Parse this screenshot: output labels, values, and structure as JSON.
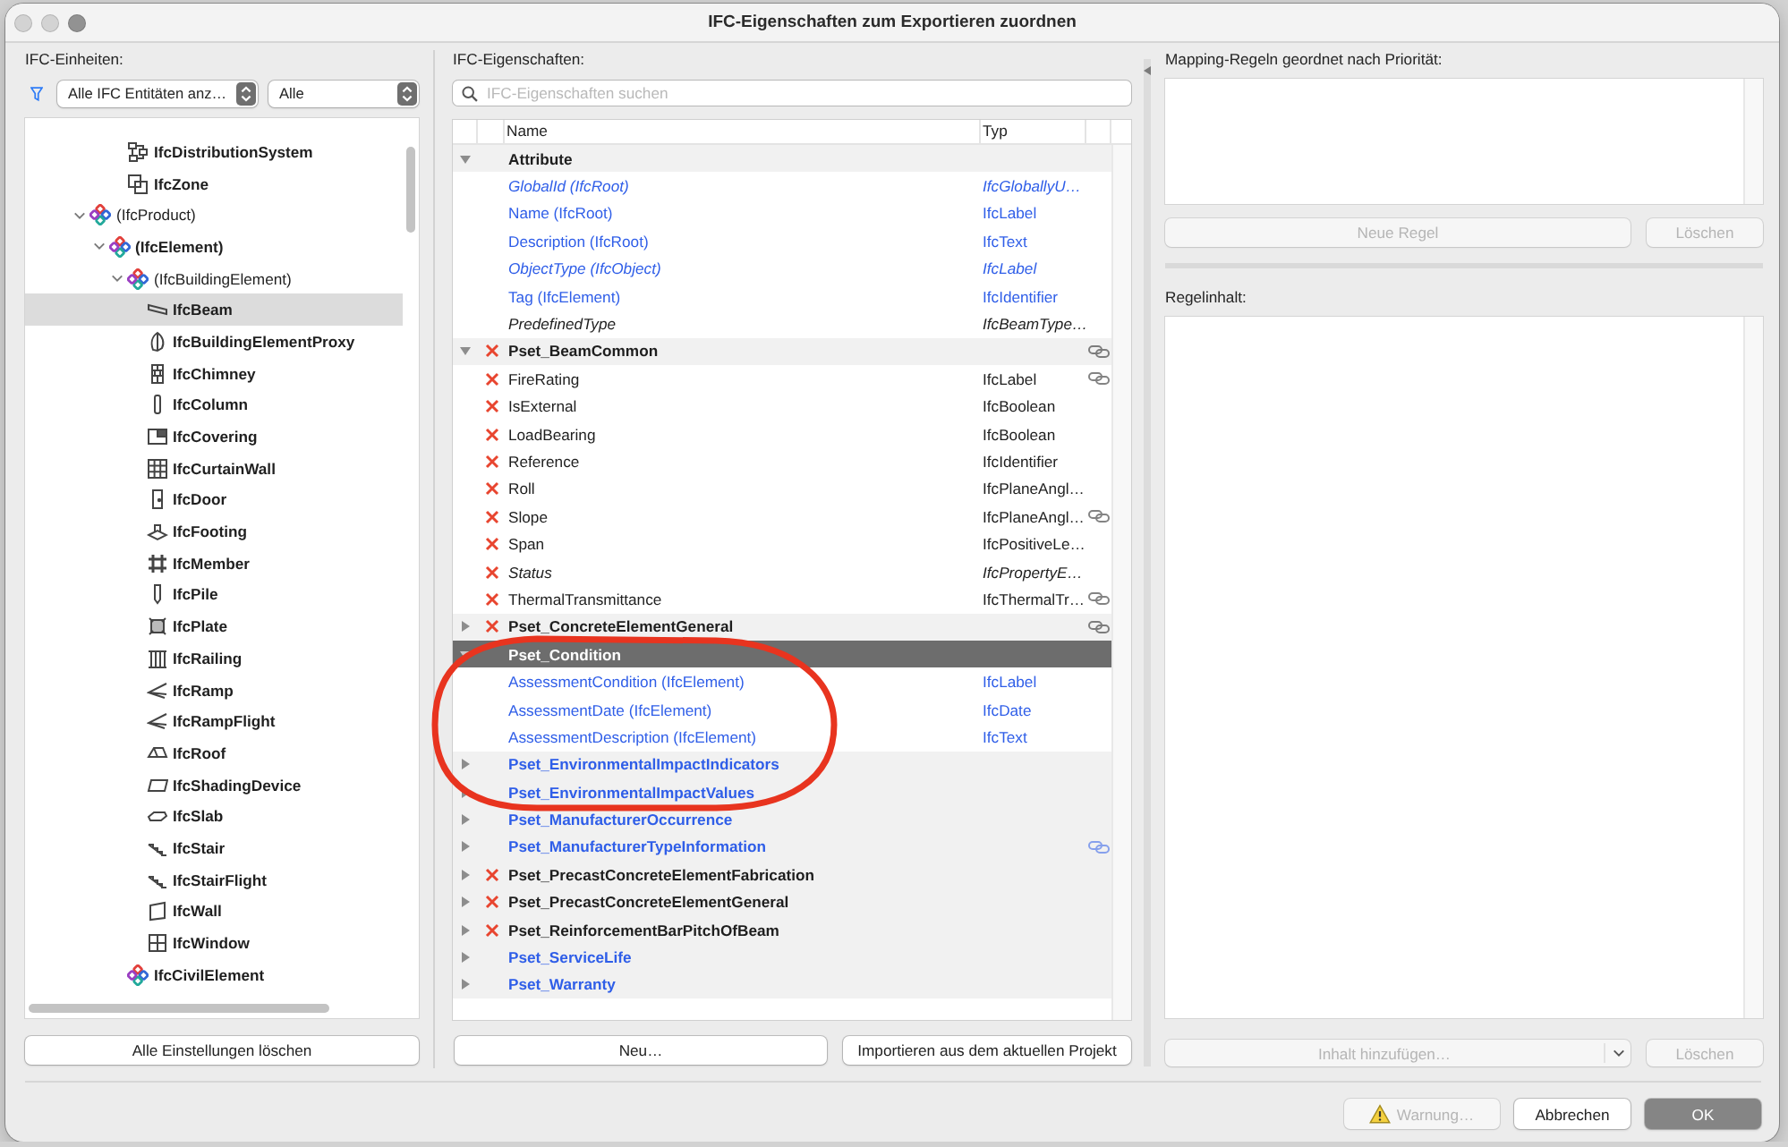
{
  "window": {
    "title": "IFC-Eigenschaften zum Exportieren zuordnen",
    "controls": [
      {
        "disabled": true
      },
      {
        "disabled": true
      },
      {
        "disabled": false
      }
    ]
  },
  "entities_panel": {
    "label": "IFC-Einheiten:",
    "filter_dropdown": "Alle IFC Entitäten anz…",
    "scope_dropdown": "Alle",
    "tree": {
      "upper_branch_items": [
        {
          "label": "IfcDistributionSystem",
          "kind": "system",
          "bold": true,
          "selected": false
        },
        {
          "label": "IfcZone",
          "kind": "zone",
          "bold": true,
          "selected": false
        }
      ],
      "items": [
        {
          "label": "(IfcProduct)",
          "kind": "group",
          "bold": false,
          "selected": false,
          "expanded": true,
          "children": [
            {
              "label": "(IfcElement)",
              "kind": "group",
              "bold": true,
              "selected": false,
              "expanded": true,
              "children": [
                {
                  "label": "(IfcBuildingElement)",
                  "kind": "group",
                  "bold": false,
                  "selected": false,
                  "expanded": true,
                  "children": [
                    {
                      "label": "IfcBeam",
                      "kind": "beam",
                      "bold": true,
                      "selected": true
                    },
                    {
                      "label": "IfcBuildingElementProxy",
                      "kind": "proxy",
                      "bold": true,
                      "selected": false
                    },
                    {
                      "label": "IfcChimney",
                      "kind": "chimney",
                      "bold": true,
                      "selected": false
                    },
                    {
                      "label": "IfcColumn",
                      "kind": "column",
                      "bold": true,
                      "selected": false
                    },
                    {
                      "label": "IfcCovering",
                      "kind": "covering",
                      "bold": true,
                      "selected": false
                    },
                    {
                      "label": "IfcCurtainWall",
                      "kind": "curtainwall",
                      "bold": true,
                      "selected": false
                    },
                    {
                      "label": "IfcDoor",
                      "kind": "door",
                      "bold": true,
                      "selected": false
                    },
                    {
                      "label": "IfcFooting",
                      "kind": "footing",
                      "bold": true,
                      "selected": false
                    },
                    {
                      "label": "IfcMember",
                      "kind": "member",
                      "bold": true,
                      "selected": false
                    },
                    {
                      "label": "IfcPile",
                      "kind": "pile",
                      "bold": true,
                      "selected": false
                    },
                    {
                      "label": "IfcPlate",
                      "kind": "plate",
                      "bold": true,
                      "selected": false
                    },
                    {
                      "label": "IfcRailing",
                      "kind": "railing",
                      "bold": true,
                      "selected": false
                    },
                    {
                      "label": "IfcRamp",
                      "kind": "ramp",
                      "bold": true,
                      "selected": false
                    },
                    {
                      "label": "IfcRampFlight",
                      "kind": "ramp",
                      "bold": true,
                      "selected": false
                    },
                    {
                      "label": "IfcRoof",
                      "kind": "roof",
                      "bold": true,
                      "selected": false
                    },
                    {
                      "label": "IfcShadingDevice",
                      "kind": "shading",
                      "bold": true,
                      "selected": false
                    },
                    {
                      "label": "IfcSlab",
                      "kind": "slab",
                      "bold": true,
                      "selected": false
                    },
                    {
                      "label": "IfcStair",
                      "kind": "stair",
                      "bold": true,
                      "selected": false
                    },
                    {
                      "label": "IfcStairFlight",
                      "kind": "stair",
                      "bold": true,
                      "selected": false
                    },
                    {
                      "label": "IfcWall",
                      "kind": "wall",
                      "bold": true,
                      "selected": false
                    },
                    {
                      "label": "IfcWindow",
                      "kind": "window",
                      "bold": true,
                      "selected": false
                    }
                  ]
                },
                {
                  "label": "IfcCivilElement",
                  "kind": "group",
                  "bold": true,
                  "selected": false
                }
              ]
            }
          ]
        }
      ]
    },
    "button": {
      "label": "Alle Einstellungen löschen"
    }
  },
  "properties_panel": {
    "label": "IFC-Eigenschaften:",
    "search": {
      "placeholder": "IFC-Eigenschaften suchen"
    },
    "columns": [
      "Name",
      "Typ"
    ],
    "property_sets": [
      {
        "name": "Attribute",
        "expanded": true,
        "selected": false,
        "excluded": false,
        "linked": false,
        "color": "#1e1e1e",
        "properties": [
          {
            "name": "GlobalId (IfcRoot)",
            "type": "IfcGloballyU…",
            "excluded": false,
            "italic": true,
            "linked": false,
            "selected": false,
            "color": "#2f5ee8"
          },
          {
            "name": "Name (IfcRoot)",
            "type": "IfcLabel",
            "excluded": false,
            "italic": false,
            "linked": false,
            "selected": false,
            "color": "#2f5ee8"
          },
          {
            "name": "Description (IfcRoot)",
            "type": "IfcText",
            "excluded": false,
            "italic": false,
            "linked": false,
            "selected": false,
            "color": "#2f5ee8"
          },
          {
            "name": "ObjectType (IfcObject)",
            "type": "IfcLabel",
            "excluded": false,
            "italic": true,
            "linked": false,
            "selected": false,
            "color": "#2f5ee8"
          },
          {
            "name": "Tag (IfcElement)",
            "type": "IfcIdentifier",
            "excluded": false,
            "italic": false,
            "linked": false,
            "selected": false,
            "color": "#2f5ee8"
          },
          {
            "name": "PredefinedType",
            "type": "IfcBeamType…",
            "excluded": false,
            "italic": true,
            "linked": false,
            "selected": false,
            "color": "#1e1e1e"
          }
        ]
      },
      {
        "name": "Pset_BeamCommon",
        "expanded": true,
        "selected": false,
        "excluded": true,
        "linked": true,
        "color": "#1e1e1e",
        "properties": [
          {
            "name": "FireRating",
            "type": "IfcLabel",
            "excluded": true,
            "italic": false,
            "linked": true,
            "selected": false,
            "color": "#1e1e1e"
          },
          {
            "name": "IsExternal",
            "type": "IfcBoolean",
            "excluded": true,
            "italic": false,
            "linked": false,
            "selected": false,
            "color": "#1e1e1e"
          },
          {
            "name": "LoadBearing",
            "type": "IfcBoolean",
            "excluded": true,
            "italic": false,
            "linked": false,
            "selected": false,
            "color": "#1e1e1e"
          },
          {
            "name": "Reference",
            "type": "IfcIdentifier",
            "excluded": true,
            "italic": false,
            "linked": false,
            "selected": false,
            "color": "#1e1e1e"
          },
          {
            "name": "Roll",
            "type": "IfcPlaneAngl…",
            "excluded": true,
            "italic": false,
            "linked": false,
            "selected": false,
            "color": "#1e1e1e"
          },
          {
            "name": "Slope",
            "type": "IfcPlaneAngl…",
            "excluded": true,
            "italic": false,
            "linked": true,
            "selected": false,
            "color": "#1e1e1e"
          },
          {
            "name": "Span",
            "type": "IfcPositiveLe…",
            "excluded": true,
            "italic": false,
            "linked": false,
            "selected": false,
            "color": "#1e1e1e"
          },
          {
            "name": "Status",
            "type": "IfcPropertyE…",
            "excluded": true,
            "italic": true,
            "linked": false,
            "selected": false,
            "color": "#1e1e1e"
          },
          {
            "name": "ThermalTransmittance",
            "type": "IfcThermalTr…",
            "excluded": true,
            "italic": false,
            "linked": true,
            "selected": false,
            "color": "#1e1e1e"
          }
        ]
      },
      {
        "name": "Pset_ConcreteElementGeneral",
        "expanded": false,
        "selected": false,
        "excluded": true,
        "linked": true,
        "color": "#1e1e1e"
      },
      {
        "name": "Pset_Condition",
        "expanded": true,
        "selected": true,
        "excluded": false,
        "linked": false,
        "properties": [
          {
            "name": "AssessmentCondition (IfcElement)",
            "type": "IfcLabel",
            "excluded": false,
            "italic": false,
            "linked": false,
            "selected": false,
            "color": "#2f5ee8"
          },
          {
            "name": "AssessmentDate (IfcElement)",
            "type": "IfcDate",
            "excluded": false,
            "italic": false,
            "linked": false,
            "selected": false,
            "color": "#2f5ee8"
          },
          {
            "name": "AssessmentDescription (IfcElement)",
            "type": "IfcText",
            "excluded": false,
            "italic": false,
            "linked": false,
            "selected": false,
            "color": "#2f5ee8"
          }
        ]
      },
      {
        "name": "Pset_EnvironmentalImpactIndicators",
        "expanded": false,
        "selected": false,
        "excluded": false,
        "linked": false,
        "color": "#2f5ee8"
      },
      {
        "name": "Pset_EnvironmentalImpactValues",
        "expanded": false,
        "selected": false,
        "excluded": false,
        "linked": false,
        "color": "#2f5ee8"
      },
      {
        "name": "Pset_ManufacturerOccurrence",
        "expanded": false,
        "selected": false,
        "excluded": false,
        "linked": false,
        "color": "#2f5ee8"
      },
      {
        "name": "Pset_ManufacturerTypeInformation",
        "expanded": false,
        "selected": false,
        "excluded": false,
        "linked": true,
        "color": "#2f5ee8"
      },
      {
        "name": "Pset_PrecastConcreteElementFabrication",
        "expanded": false,
        "selected": false,
        "excluded": true,
        "linked": false,
        "color": "#1e1e1e"
      },
      {
        "name": "Pset_PrecastConcreteElementGeneral",
        "expanded": false,
        "selected": false,
        "excluded": true,
        "linked": false,
        "color": "#1e1e1e"
      },
      {
        "name": "Pset_ReinforcementBarPitchOfBeam",
        "expanded": false,
        "selected": false,
        "excluded": true,
        "linked": false,
        "color": "#1e1e1e"
      },
      {
        "name": "Pset_ServiceLife",
        "expanded": false,
        "selected": false,
        "excluded": false,
        "linked": false,
        "color": "#2f5ee8"
      },
      {
        "name": "Pset_Warranty",
        "expanded": false,
        "selected": false,
        "excluded": false,
        "linked": false,
        "color": "#2f5ee8"
      }
    ],
    "buttons": [
      {
        "label": "Neu…",
        "disabled": false
      },
      {
        "label": "Importieren aus dem aktuellen Projekt",
        "disabled": false
      }
    ]
  },
  "rules_panel": {
    "label": "Mapping-Regeln geordnet nach Priorität:",
    "buttons": [
      {
        "label": "Neue Regel",
        "disabled": true
      },
      {
        "label": "Löschen",
        "disabled": true
      }
    ]
  },
  "rule_content": {
    "label": "Regelinhalt:",
    "add_dropdown": {
      "label": "Inhalt hinzufügen…",
      "disabled": true
    },
    "delete_button": {
      "label": "Löschen",
      "disabled": true
    }
  },
  "footer_buttons": [
    {
      "label": "Warnung…",
      "kind": "warning",
      "disabled": true,
      "default": false
    },
    {
      "label": "Abbrechen",
      "kind": "plain",
      "disabled": false,
      "default": false
    },
    {
      "label": "OK",
      "kind": "plain",
      "disabled": false,
      "default": true
    }
  ]
}
